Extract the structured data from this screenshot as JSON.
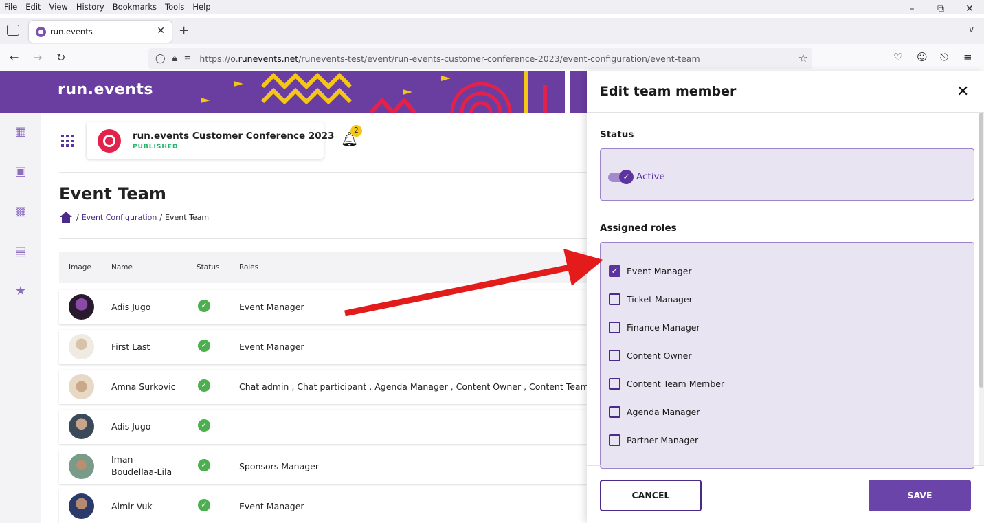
{
  "browser": {
    "menu": [
      "File",
      "Edit",
      "View",
      "History",
      "Bookmarks",
      "Tools",
      "Help"
    ],
    "tab_title": "run.events",
    "url_prefix": "https://o.",
    "url_domain": "runevents.net",
    "url_path": "/runevents-test/event/run-events-customer-conference-2023/event-configuration/event-team"
  },
  "app": {
    "logo_text": "run.events",
    "event_title": "run.events Customer Conference 2023",
    "event_status": "PUBLISHED",
    "notification_count": "2"
  },
  "page": {
    "title": "Event Team",
    "breadcrumb_sep": "/",
    "breadcrumb_link": "Event Configuration",
    "breadcrumb_current": "Event Team"
  },
  "table": {
    "headers": [
      "Image",
      "Name",
      "Status",
      "Roles"
    ],
    "rows": [
      {
        "name": "Adis Jugo",
        "roles": "Event Manager"
      },
      {
        "name": "First Last",
        "roles": "Event Manager"
      },
      {
        "name": "Amna Surkovic",
        "roles": "Chat admin , Chat participant , Agenda Manager , Content Owner , Content Team Member"
      },
      {
        "name": "Adis Jugo",
        "roles": ""
      },
      {
        "name": "Iman Boudellaa-Lila",
        "roles": "Sponsors Manager"
      },
      {
        "name": "Almir Vuk",
        "roles": "Event Manager"
      }
    ]
  },
  "panel": {
    "title": "Edit team member",
    "status_label": "Status",
    "toggle_label": "Active",
    "toggle_on": true,
    "roles_label": "Assigned roles",
    "roles": [
      {
        "label": "Event Manager",
        "checked": true
      },
      {
        "label": "Ticket Manager",
        "checked": false
      },
      {
        "label": "Finance Manager",
        "checked": false
      },
      {
        "label": "Content Owner",
        "checked": false
      },
      {
        "label": "Content Team Member",
        "checked": false
      },
      {
        "label": "Agenda Manager",
        "checked": false
      },
      {
        "label": "Partner Manager",
        "checked": false
      }
    ],
    "cancel_label": "CANCEL",
    "save_label": "SAVE"
  },
  "colors": {
    "brand_purple": "#6a3ea0",
    "accent_purple": "#5b34a0",
    "published_green": "#23b26a",
    "annotation_arrow": "#e31b1b"
  }
}
